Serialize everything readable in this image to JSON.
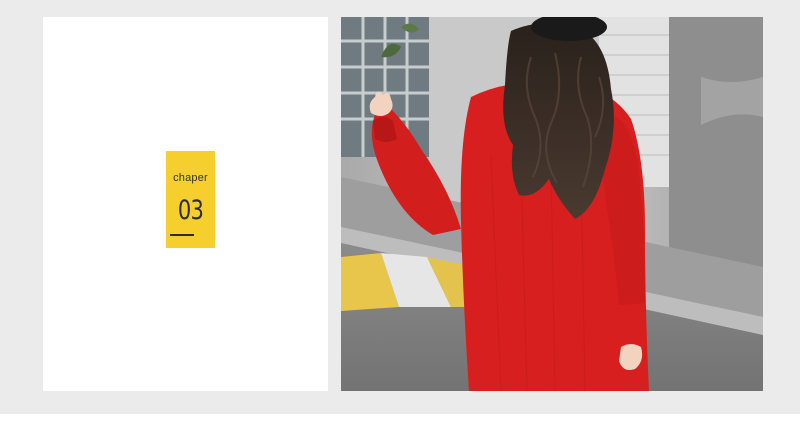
{
  "chapter": {
    "label": "chaper",
    "number": "03"
  },
  "colors": {
    "frame_background": "#ebebeb",
    "left_panel": "#ffffff",
    "chapter_tag": "#f6cf2e",
    "sweater_red": "#d81f1f"
  },
  "photo": {
    "icon": "product-photo-girl-red-sweater"
  }
}
